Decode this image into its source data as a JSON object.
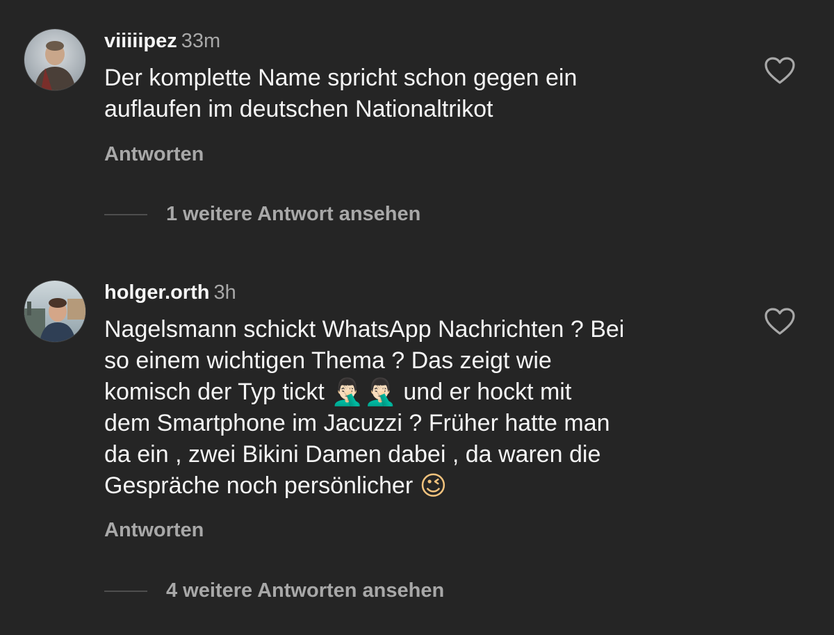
{
  "comments": [
    {
      "username": "viiiiipez",
      "time": "33m",
      "text_lines": [
        "Der komplette Name spricht schon gegen ein",
        "auflaufen im deutschen Nationaltrikot"
      ],
      "reply_label": "Antworten",
      "more_replies": "1 weitere Antwort ansehen",
      "like_icon": "heart-outline-icon"
    },
    {
      "username": "holger.orth",
      "time": "3h",
      "text_lines": [
        "Nagelsmann schickt WhatsApp Nachrichten ? Bei",
        "so einem wichtigen Thema ? Das zeigt wie",
        "komisch der Typ tickt",
        "und er hockt mit",
        "dem Smartphone im Jacuzzi ? Früher hatte man",
        "da ein , zwei Bikini Damen dabei , da waren die",
        "Gespräche noch persönlicher"
      ],
      "emojis": {
        "facepalm": "🤦🏻‍♂️",
        "wink": "😉"
      },
      "reply_label": "Antworten",
      "more_replies": "4 weitere Antworten ansehen",
      "like_icon": "heart-outline-icon"
    }
  ],
  "colors": {
    "background": "#252525",
    "text": "#f5f5f5",
    "muted": "#a8a8a8"
  }
}
